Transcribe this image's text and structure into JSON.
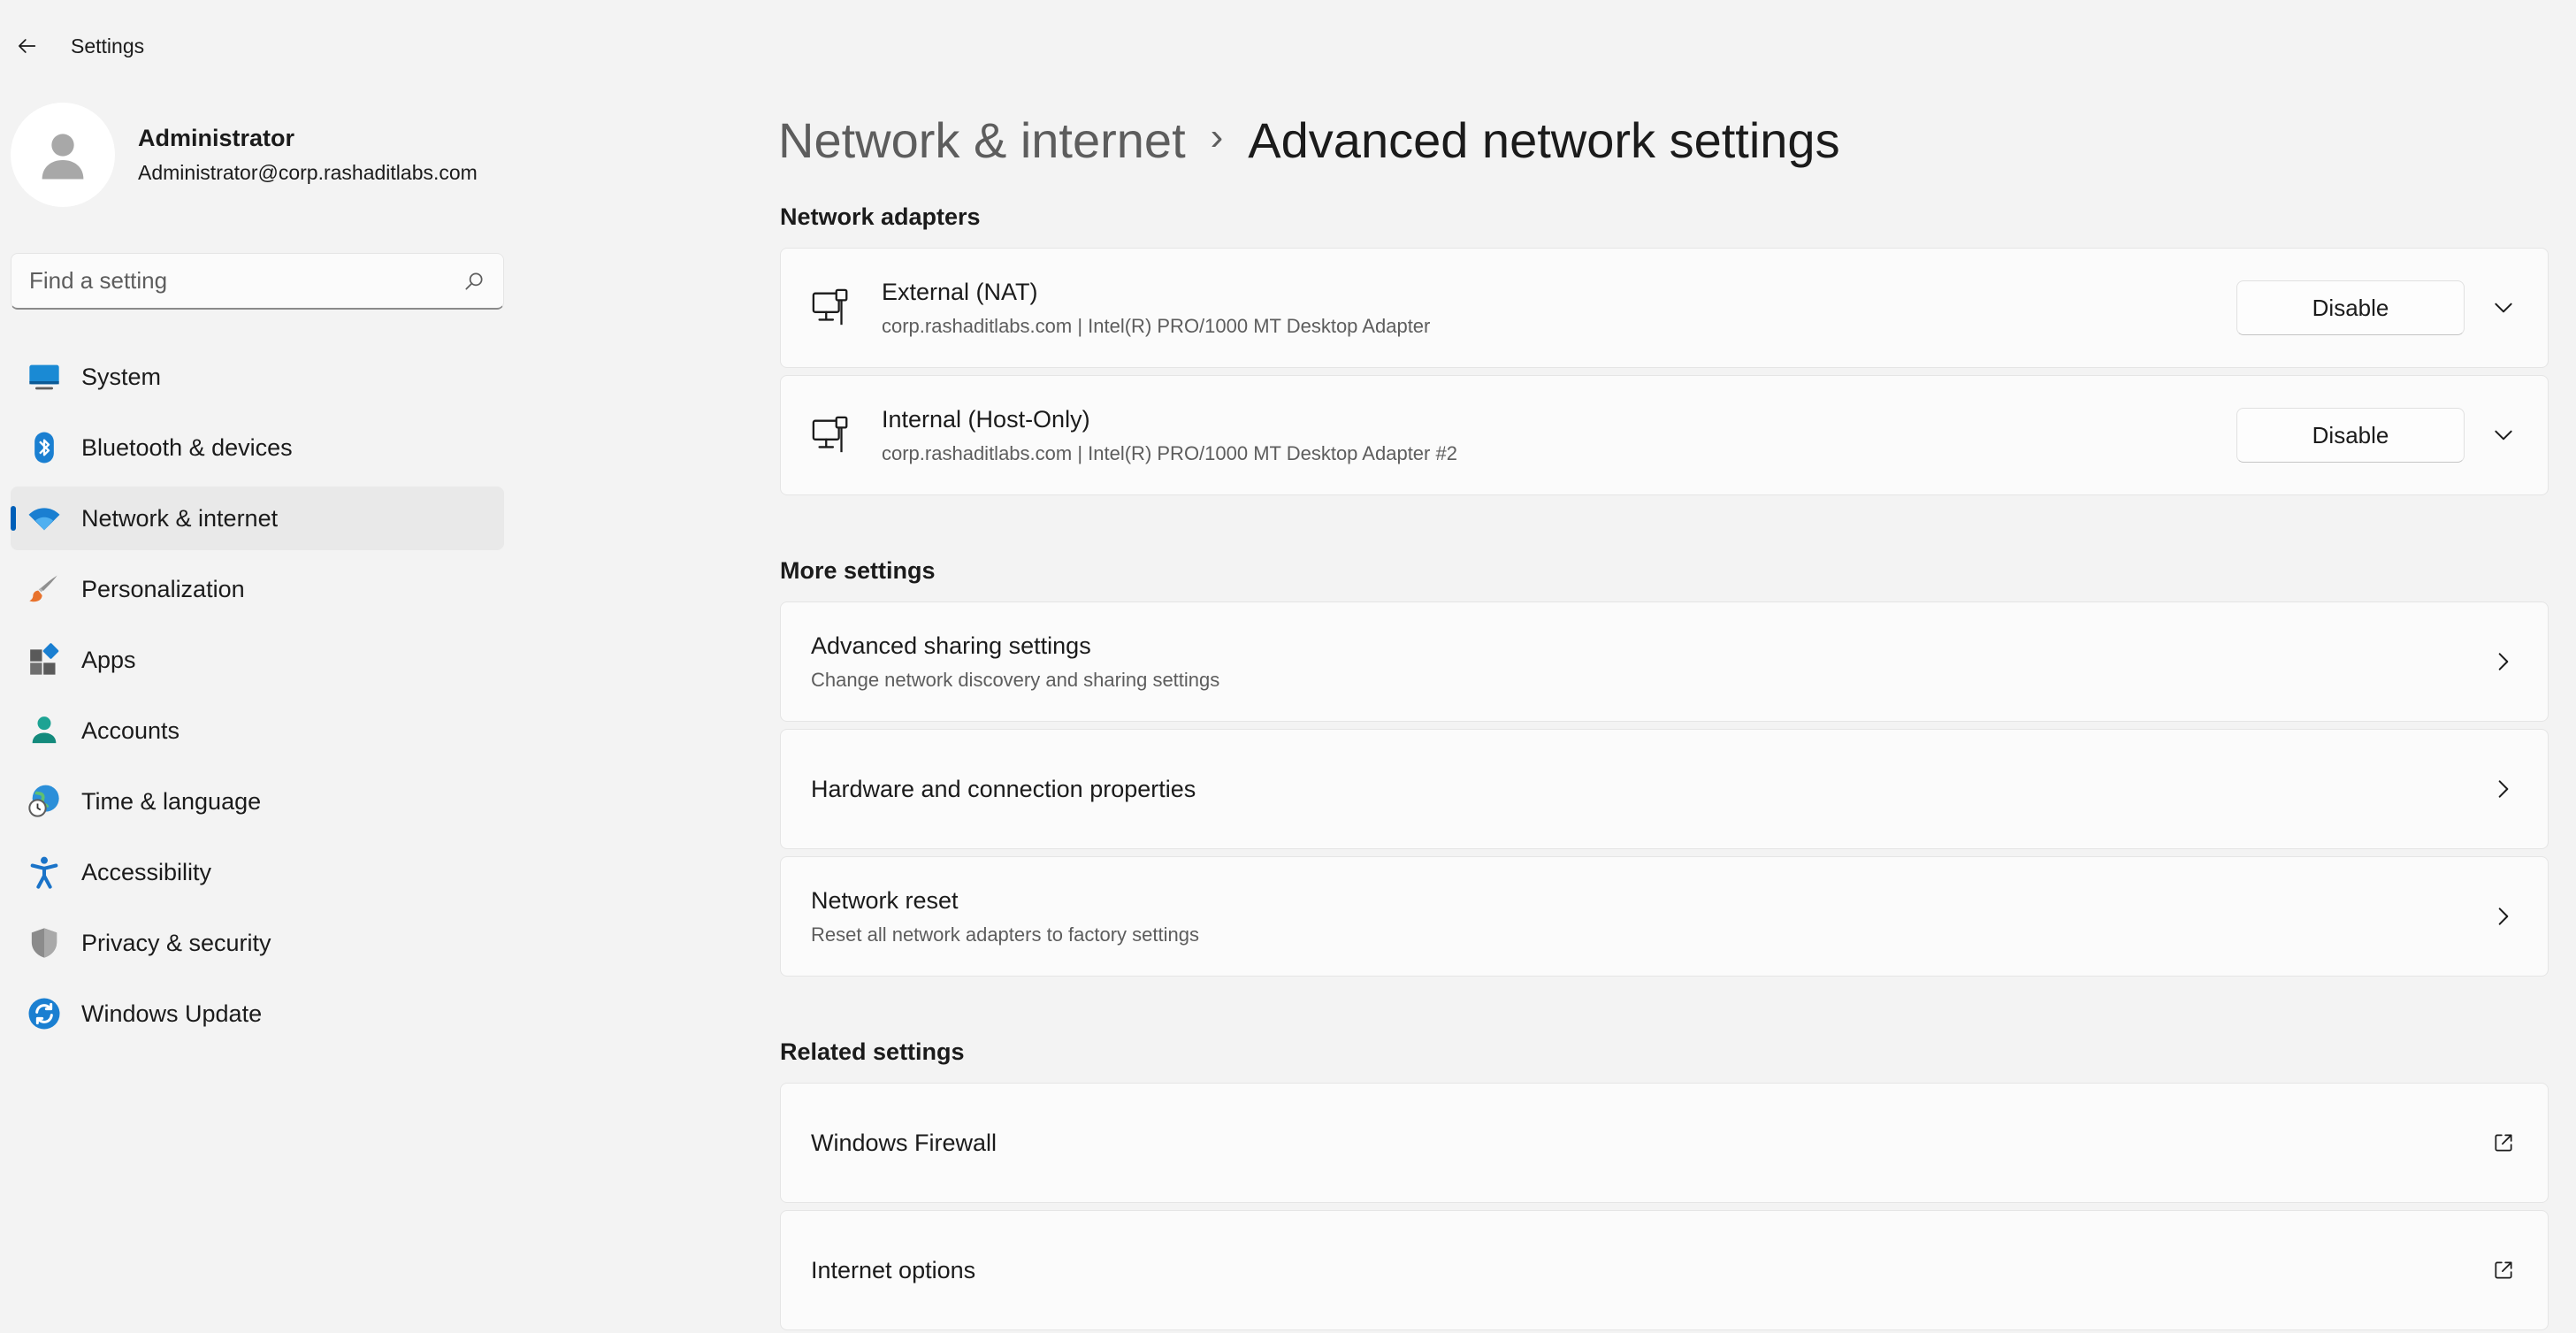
{
  "window": {
    "title": "Settings"
  },
  "profile": {
    "name": "Administrator",
    "email": "Administrator@corp.rashaditlabs.com"
  },
  "search": {
    "placeholder": "Find a setting"
  },
  "sidebar": {
    "items": [
      {
        "label": "System",
        "icon": "system-icon"
      },
      {
        "label": "Bluetooth & devices",
        "icon": "bluetooth-icon"
      },
      {
        "label": "Network & internet",
        "icon": "wifi-icon",
        "active": true
      },
      {
        "label": "Personalization",
        "icon": "brush-icon"
      },
      {
        "label": "Apps",
        "icon": "apps-icon"
      },
      {
        "label": "Accounts",
        "icon": "person-icon"
      },
      {
        "label": "Time & language",
        "icon": "globe-clock-icon"
      },
      {
        "label": "Accessibility",
        "icon": "accessibility-icon"
      },
      {
        "label": "Privacy & security",
        "icon": "shield-icon"
      },
      {
        "label": "Windows Update",
        "icon": "update-icon"
      }
    ]
  },
  "breadcrumb": {
    "parent": "Network & internet",
    "separator": "›",
    "current": "Advanced network settings"
  },
  "sections": {
    "adapters": {
      "title": "Network adapters",
      "items": [
        {
          "title": "External (NAT)",
          "subtitle": "corp.rashaditlabs.com | Intel(R) PRO/1000 MT Desktop Adapter",
          "button": "Disable"
        },
        {
          "title": "Internal (Host-Only)",
          "subtitle": "corp.rashaditlabs.com | Intel(R) PRO/1000 MT Desktop Adapter #2",
          "button": "Disable"
        }
      ]
    },
    "more": {
      "title": "More settings",
      "items": [
        {
          "title": "Advanced sharing settings",
          "subtitle": "Change network discovery and sharing settings"
        },
        {
          "title": "Hardware and connection properties",
          "subtitle": ""
        },
        {
          "title": "Network reset",
          "subtitle": "Reset all network adapters to factory settings"
        }
      ]
    },
    "related": {
      "title": "Related settings",
      "items": [
        {
          "title": "Windows Firewall"
        },
        {
          "title": "Internet options"
        }
      ]
    }
  },
  "colors": {
    "accent": "#005fb8",
    "background": "#f3f3f3",
    "card": "#fbfbfb"
  }
}
